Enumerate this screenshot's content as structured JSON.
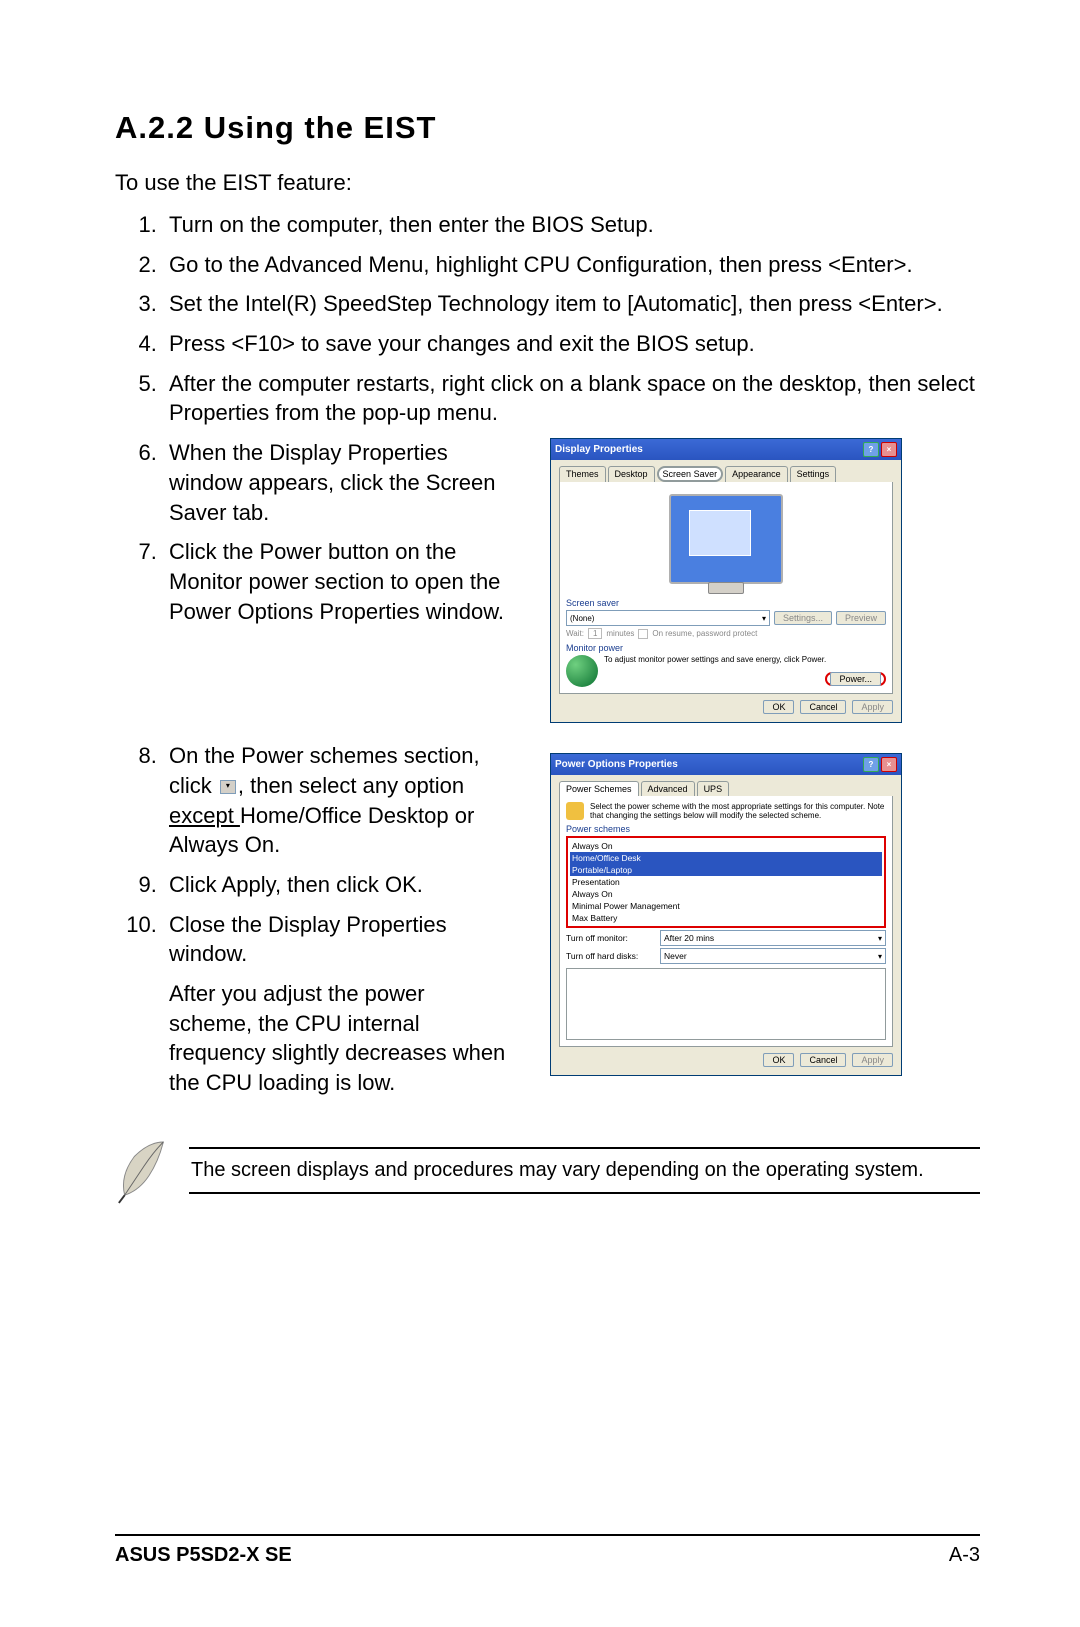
{
  "heading": "A.2.2   Using the EIST",
  "intro": "To use the EIST feature:",
  "steps_top": [
    "Turn on the computer, then enter the BIOS Setup.",
    "Go to the Advanced Menu, highlight CPU Configuration, then press <Enter>.",
    "Set the Intel(R) SpeedStep Technology item to [Automatic], then press <Enter>.",
    "Press <F10> to save your changes and exit the BIOS setup.",
    "After the computer restarts, right click on a blank space on the desktop, then select Properties from the pop-up menu."
  ],
  "steps_mid": [
    "When the Display Properties window appears, click the Screen Saver tab.",
    "Click the Power button on the Monitor power section to open the Power Options Properties window."
  ],
  "step8_pre": "On the Power schemes section, click ",
  "step8_post": ", then select any option ",
  "step8_except": "except ",
  "step8_tail": "Home/Office Desktop or Always On.",
  "steps_bot": [
    "Click Apply, then click OK.",
    "Close the Display Properties window."
  ],
  "after_note": "After you adjust the power scheme, the CPU internal frequency slightly decreases when the CPU loading is low.",
  "display_props": {
    "title": "Display Properties",
    "tabs": [
      "Themes",
      "Desktop",
      "Screen Saver",
      "Appearance",
      "Settings"
    ],
    "screen_saver_label": "Screen saver",
    "ss_value": "(None)",
    "settings_btn": "Settings...",
    "preview_btn": "Preview",
    "wait_label": "Wait:",
    "wait_value": "1",
    "wait_unit": "minutes",
    "resume_chk": "On resume, password protect",
    "monitor_power_label": "Monitor power",
    "monitor_power_desc": "To adjust monitor power settings and save energy, click Power.",
    "power_btn": "Power...",
    "ok": "OK",
    "cancel": "Cancel",
    "apply": "Apply"
  },
  "power_opts": {
    "title": "Power Options Properties",
    "tabs": [
      "Power Schemes",
      "Advanced",
      "UPS"
    ],
    "desc": "Select the power scheme with the most appropriate settings for this computer. Note that changing the settings below will modify the selected scheme.",
    "schemes_label": "Power schemes",
    "schemes": [
      "Always On",
      "Home/Office Desk",
      "Portable/Laptop",
      "Presentation",
      "Always On",
      "Minimal Power Management",
      "Max Battery"
    ],
    "turnoff_monitor_label": "Turn off monitor:",
    "turnoff_monitor_val": "After 20 mins",
    "turnoff_hdd_label": "Turn off hard disks:",
    "turnoff_hdd_val": "Never",
    "ok": "OK",
    "cancel": "Cancel",
    "apply": "Apply"
  },
  "note": "The screen displays and procedures may vary depending on the operating system.",
  "footer_product": "ASUS P5SD2-X SE",
  "footer_page": "A-3"
}
